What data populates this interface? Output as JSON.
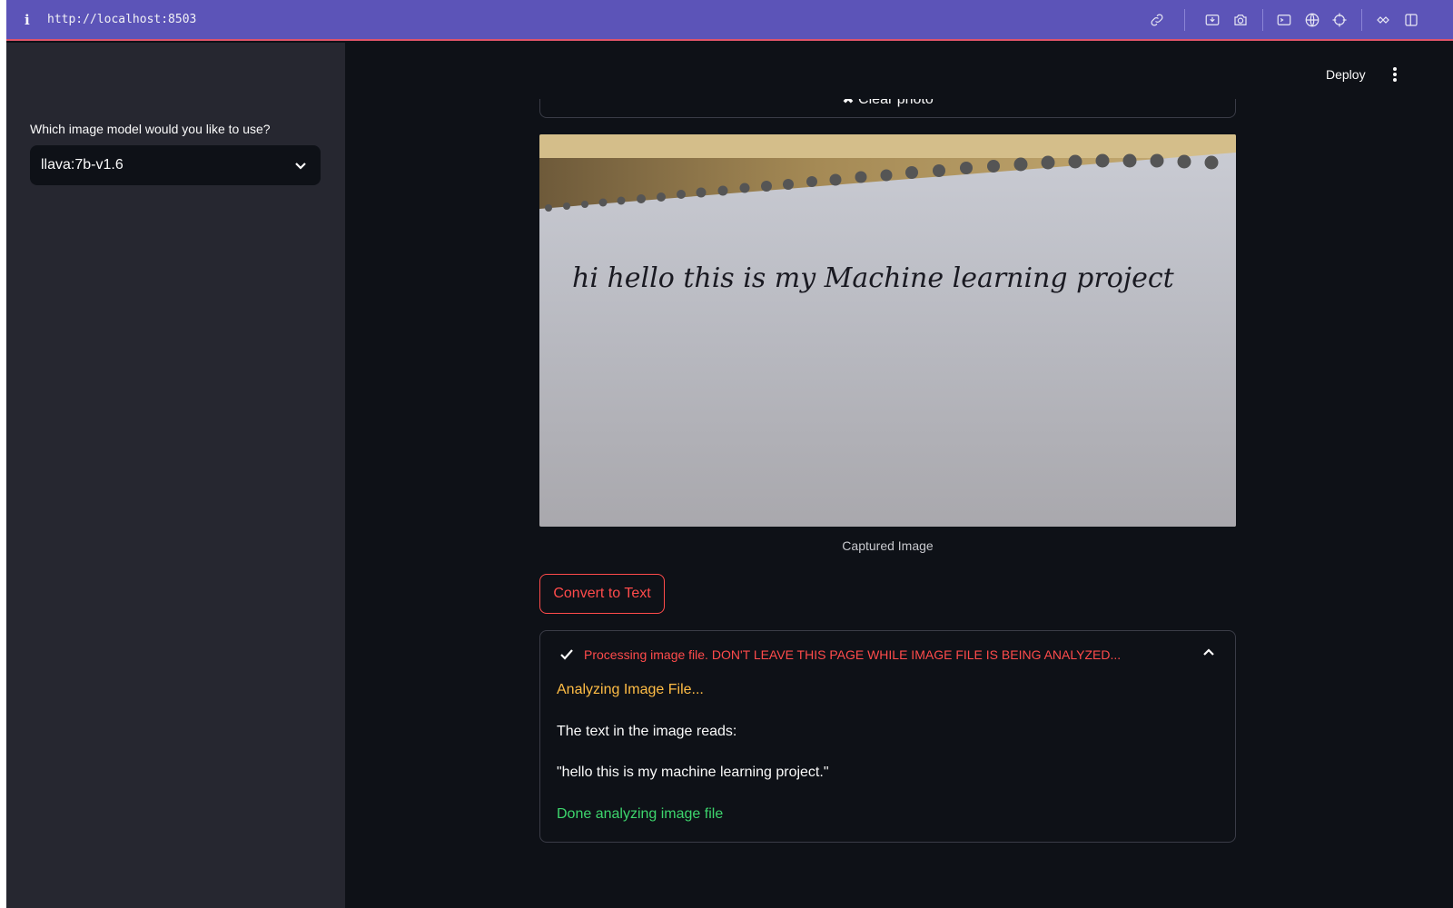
{
  "browser": {
    "url": "http://localhost:8503",
    "icons": [
      "link-icon",
      "screenshot-icon",
      "camera-icon",
      "terminal-icon",
      "globe-icon",
      "crosshair-icon",
      "extensions-icon",
      "sidebar-toggle-icon"
    ]
  },
  "sidebar": {
    "label": "Which image model would you like to use?",
    "selected_model": "llava:7b-v1.6"
  },
  "header": {
    "deploy_label": "Deploy"
  },
  "main": {
    "clear_photo_label": "✖ Clear photo",
    "captured_image_text": "hi hello this is my Machine learning project",
    "caption": "Captured Image",
    "convert_button_label": "Convert to Text",
    "status": {
      "title": "Processing image file. DON'T LEAVE THIS PAGE WHILE IMAGE FILE IS BEING ANALYZED...",
      "analyzing": "Analyzing Image File...",
      "reads": "The text in the image reads:",
      "quote": "\"hello this is my machine learning project.\"",
      "done": "Done analyzing image file"
    }
  },
  "colors": {
    "accent": "#ff4b4b",
    "warning": "#ffbd45",
    "success": "#3dd56d",
    "browser_bar": "#5c54b8",
    "sidebar_bg": "#262730",
    "main_bg": "#0e1117"
  }
}
